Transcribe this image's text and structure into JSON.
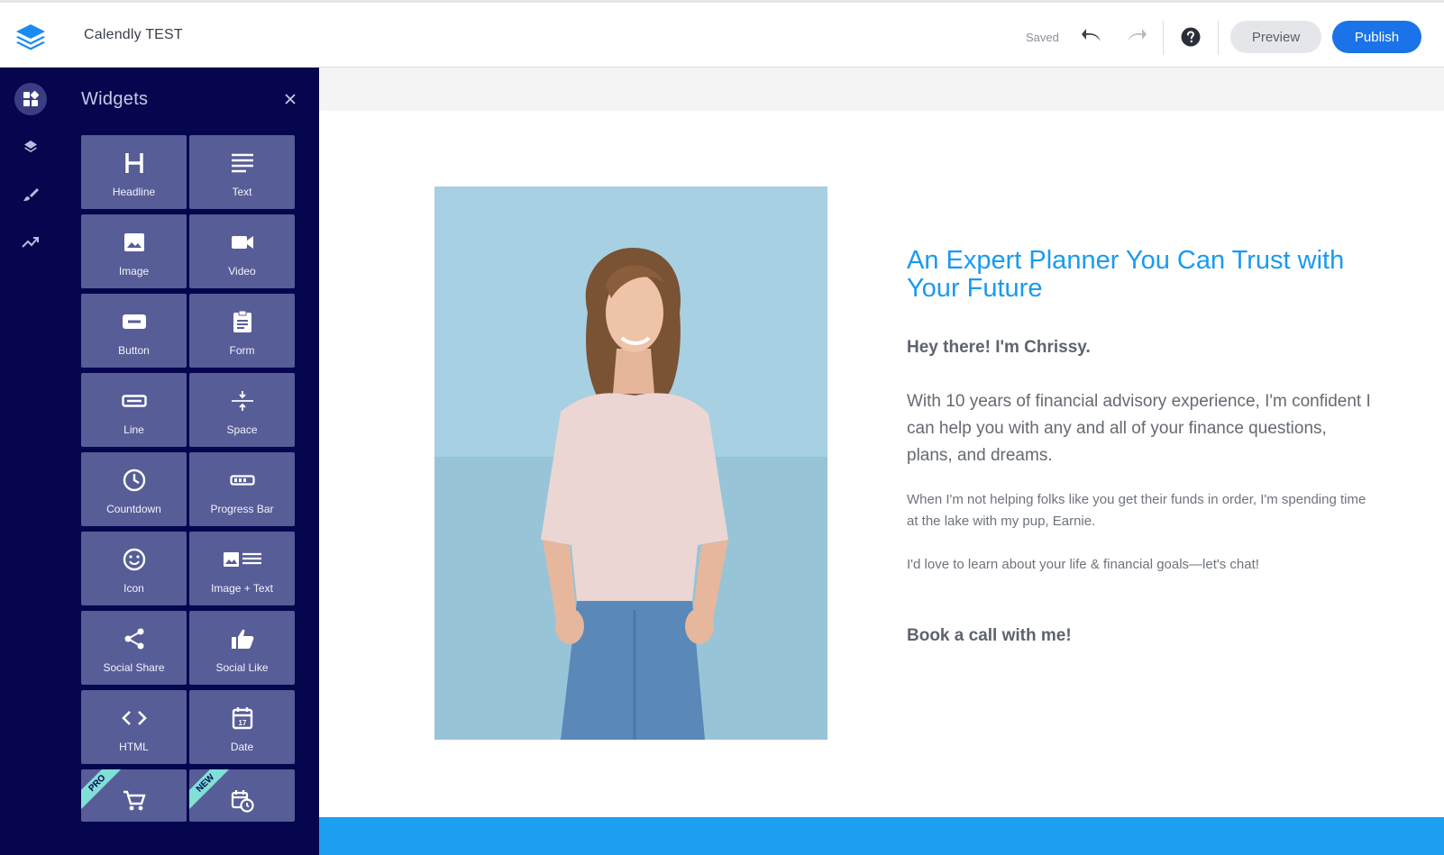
{
  "header": {
    "title": "Calendly TEST",
    "status": "Saved",
    "preview_label": "Preview",
    "publish_label": "Publish",
    "accent": "#1a73e8"
  },
  "rail": {
    "items": [
      {
        "icon": "widgets-icon",
        "active": true
      },
      {
        "icon": "layers-icon"
      },
      {
        "icon": "brush-icon"
      },
      {
        "icon": "analytics-icon"
      }
    ]
  },
  "panel": {
    "title": "Widgets",
    "widgets": [
      {
        "label": "Headline",
        "icon": "headline-icon"
      },
      {
        "label": "Text",
        "icon": "text-icon"
      },
      {
        "label": "Image",
        "icon": "image-icon"
      },
      {
        "label": "Video",
        "icon": "video-icon"
      },
      {
        "label": "Button",
        "icon": "button-icon"
      },
      {
        "label": "Form",
        "icon": "form-icon"
      },
      {
        "label": "Line",
        "icon": "line-icon"
      },
      {
        "label": "Space",
        "icon": "space-icon"
      },
      {
        "label": "Countdown",
        "icon": "countdown-icon"
      },
      {
        "label": "Progress Bar",
        "icon": "progress-bar-icon"
      },
      {
        "label": "Icon",
        "icon": "smiley-icon"
      },
      {
        "label": "Image + Text",
        "icon": "image-text-icon"
      },
      {
        "label": "Social Share",
        "icon": "share-icon"
      },
      {
        "label": "Social Like",
        "icon": "thumbs-up-icon"
      },
      {
        "label": "HTML",
        "icon": "code-icon"
      },
      {
        "label": "Date",
        "icon": "calendar-icon"
      },
      {
        "label": "",
        "icon": "cart-icon",
        "ribbon": "PRO"
      },
      {
        "label": "",
        "icon": "schedule-icon",
        "ribbon": "NEW"
      }
    ]
  },
  "content": {
    "heading": "An Expert Planner You Can Trust with Your Future",
    "greeting": "Hey there! I'm Chrissy.",
    "paragraph1": "With 10 years of financial advisory experience, I'm confident I can help you with any and all of your finance questions, plans, and dreams.",
    "paragraph2": "When I'm not helping folks like you get their funds in order, I'm spending time at the lake with my pup, Earnie.",
    "paragraph3": "I'd love to learn about your life & financial goals—let's chat!",
    "cta": "Book a call with me!",
    "heading_color": "#1a9af0",
    "band_color": "#1d9ff2"
  }
}
